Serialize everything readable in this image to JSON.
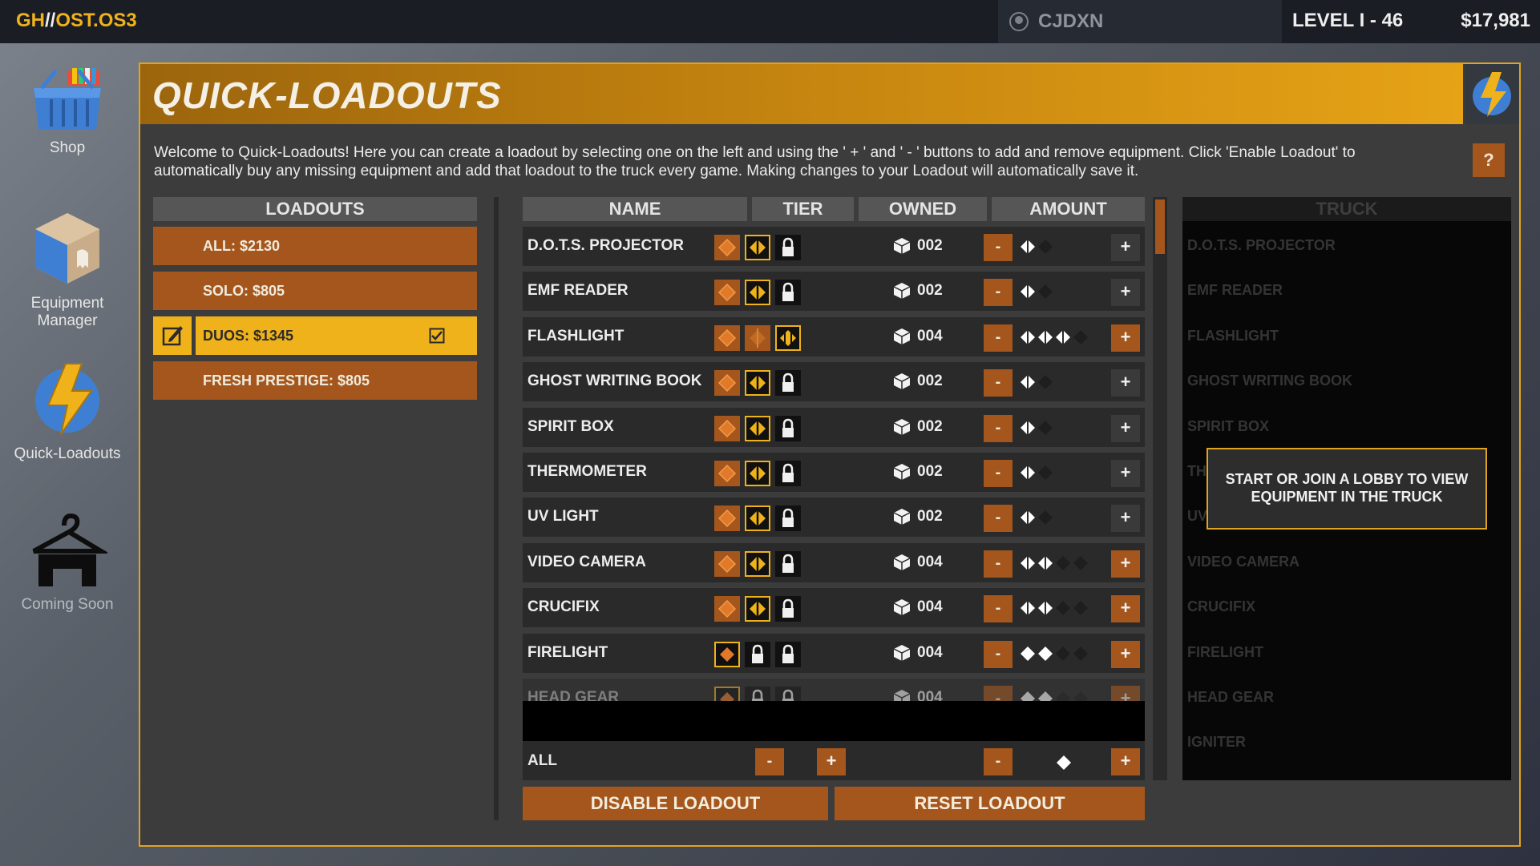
{
  "topbar": {
    "brand_left": "GH",
    "brand_sep": "//",
    "brand_right": "OST.OS3",
    "username": "CJDXN",
    "level": "LEVEL I - 46",
    "money": "$17,981"
  },
  "sidebar": [
    {
      "label": "Shop",
      "icon": "shop-basket-icon"
    },
    {
      "label": "Equipment Manager",
      "icon": "equipment-box-icon"
    },
    {
      "label": "Quick-Loadouts",
      "icon": "lightning-icon"
    },
    {
      "label": "Coming Soon",
      "icon": "hanger-icon"
    }
  ],
  "panel": {
    "title": "QUICK-LOADOUTS",
    "intro": "Welcome to Quick-Loadouts! Here you can create a loadout by selecting one on the left and using the ' + ' and ' - ' buttons to add and remove equipment. Click 'Enable Loadout' to automatically buy any missing equipment and add that loadout to the truck every game. Making changes to your Loadout will automatically save it.",
    "help": "?"
  },
  "loadouts": {
    "header": "LOADOUTS",
    "items": [
      "ALL: $2130",
      "SOLO: $805",
      "DUOS: $1345",
      "FRESH PRESTIGE: $805"
    ],
    "selected_index": 2
  },
  "table": {
    "headers": {
      "name": "NAME",
      "tier": "TIER",
      "owned": "OWNED",
      "amount": "AMOUNT"
    },
    "rows": [
      {
        "name": "D.O.T.S. PROJECTOR",
        "owned": "002",
        "amount": 1,
        "tier_unlocked": 2,
        "tier_selected": 2
      },
      {
        "name": "EMF READER",
        "owned": "002",
        "amount": 1,
        "tier_unlocked": 2,
        "tier_selected": 2
      },
      {
        "name": "FLASHLIGHT",
        "owned": "004",
        "amount": 3,
        "tier_unlocked": 3,
        "tier_selected": 3
      },
      {
        "name": "GHOST WRITING BOOK",
        "owned": "002",
        "amount": 1,
        "tier_unlocked": 2,
        "tier_selected": 2
      },
      {
        "name": "SPIRIT BOX",
        "owned": "002",
        "amount": 1,
        "tier_unlocked": 2,
        "tier_selected": 2
      },
      {
        "name": "THERMOMETER",
        "owned": "002",
        "amount": 1,
        "tier_unlocked": 2,
        "tier_selected": 2
      },
      {
        "name": "UV LIGHT",
        "owned": "002",
        "amount": 1,
        "tier_unlocked": 2,
        "tier_selected": 2
      },
      {
        "name": "VIDEO CAMERA",
        "owned": "004",
        "amount": 2,
        "tier_unlocked": 2,
        "tier_selected": 2
      },
      {
        "name": "CRUCIFIX",
        "owned": "004",
        "amount": 2,
        "tier_unlocked": 2,
        "tier_selected": 2
      },
      {
        "name": "FIRELIGHT",
        "owned": "004",
        "amount": 2,
        "tier_unlocked": 1,
        "tier_selected": 1
      },
      {
        "name": "HEAD GEAR",
        "owned": "004",
        "amount": 2,
        "tier_unlocked": 1,
        "tier_selected": 1
      }
    ],
    "all_label": "ALL",
    "minus": "-",
    "plus": "+"
  },
  "buttons": {
    "disable": "DISABLE LOADOUT",
    "reset": "RESET LOADOUT"
  },
  "truck": {
    "header": "TRUCK",
    "items": [
      "D.O.T.S. PROJECTOR",
      "EMF READER",
      "FLASHLIGHT",
      "GHOST WRITING BOOK",
      "SPIRIT BOX",
      "TH",
      "UV",
      "VIDEO CAMERA",
      "CRUCIFIX",
      "FIRELIGHT",
      "HEAD GEAR",
      "IGNITER"
    ],
    "tooltip": "START OR JOIN A LOBBY TO VIEW EQUIPMENT IN THE TRUCK"
  },
  "colors": {
    "accent": "#f0b21b",
    "button": "#a5561c",
    "panel": "#3c3c3c",
    "row": "#2a2a2a"
  }
}
